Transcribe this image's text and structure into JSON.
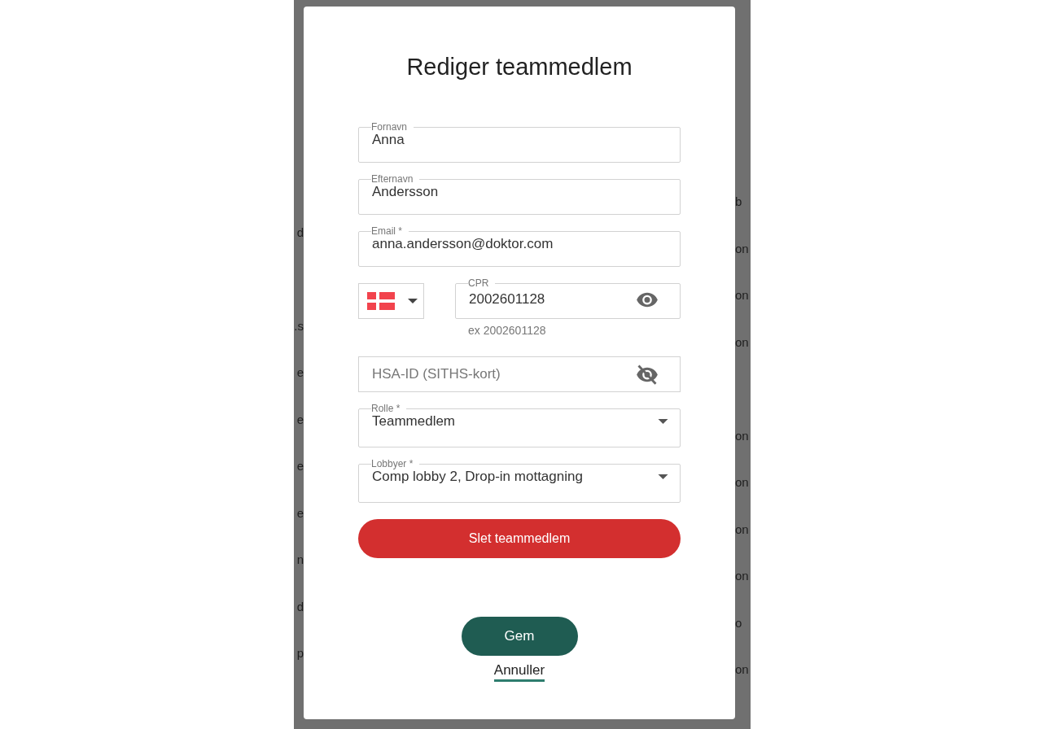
{
  "backdrop": {
    "rows": [
      {
        "right": "b"
      },
      {
        "left": "d",
        "right": "on"
      },
      {
        "right": "on"
      },
      {
        "left": ".s",
        "right": "on"
      },
      {
        "left": "e"
      },
      {
        "left": "e",
        "right": "on"
      },
      {
        "left": "e",
        "right": "on"
      },
      {
        "left": "e",
        "right": "on"
      },
      {
        "left": "n",
        "right": "on"
      },
      {
        "left": "d",
        "right": "o"
      },
      {
        "left": "p",
        "right": "on"
      }
    ]
  },
  "dialog": {
    "title": "Rediger teammedlem",
    "fields": [
      {
        "kind": "text",
        "label": "Fornavn",
        "value": "Anna"
      },
      {
        "kind": "text",
        "label": "Efternavn",
        "value": "Andersson"
      },
      {
        "kind": "text",
        "label": "Email *",
        "value": "anna.andersson@doktor.com"
      },
      {
        "kind": "cpr",
        "label": "CPR",
        "value": "2002601128",
        "helper": "ex 2002601128",
        "visible": true
      },
      {
        "kind": "secret",
        "placeholder": "HSA-ID (SITHS-kort)",
        "visible": false
      },
      {
        "kind": "select",
        "label": "Rolle *",
        "value": "Teammedlem"
      },
      {
        "kind": "select",
        "label": "Lobbyer *",
        "value": "Comp lobby 2, Drop-in mottagning"
      }
    ],
    "delete_button": "Slet teammedlem",
    "save_button": "Gem",
    "cancel_link": "Annuller"
  }
}
